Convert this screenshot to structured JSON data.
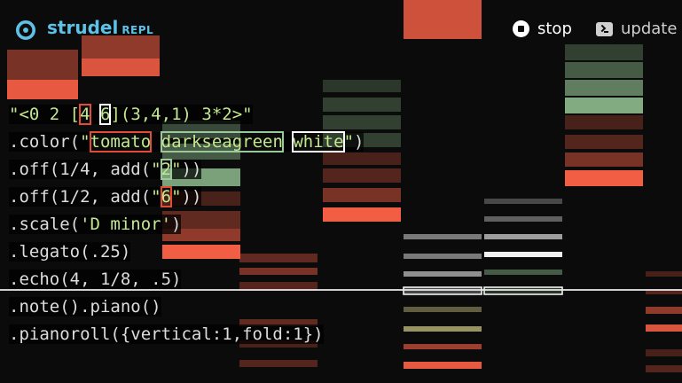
{
  "header": {
    "title": "strudel",
    "subtitle": "REPL",
    "stop_label": "stop",
    "update_label": "update",
    "icons": [
      "strudel-logo-icon",
      "stop-icon",
      "update-icon"
    ]
  },
  "colors": {
    "tomato": "#ff6347",
    "darkseagreen": "#8fbc8f",
    "white": "#ffffff",
    "brand": "#5ec2e6"
  },
  "code": {
    "lines": [
      {
        "segments": [
          {
            "t": "\"<0 2 [",
            "c": "str"
          },
          {
            "t": "4",
            "c": "str",
            "h": "red"
          },
          {
            "t": " ",
            "c": "str"
          },
          {
            "t": "6",
            "c": "str",
            "h": "white"
          },
          {
            "t": "](3,4,1) 3*2>\"",
            "c": "str"
          }
        ]
      },
      {
        "segments": [
          {
            "t": ".color(",
            "c": "text"
          },
          {
            "t": "\"",
            "c": "str"
          },
          {
            "t": "tomato",
            "c": "str",
            "h": "red"
          },
          {
            "t": " ",
            "c": "str"
          },
          {
            "t": "darkseagreen",
            "c": "str",
            "h": "green"
          },
          {
            "t": " ",
            "c": "str"
          },
          {
            "t": "white",
            "c": "str",
            "h": "white"
          },
          {
            "t": "\"",
            "c": "str"
          },
          {
            "t": ")",
            "c": "text"
          }
        ]
      },
      {
        "segments": [
          {
            "t": ".off(1/4, add(",
            "c": "text"
          },
          {
            "t": "\"",
            "c": "str"
          },
          {
            "t": "2",
            "c": "str",
            "h": "green"
          },
          {
            "t": "\"",
            "c": "str"
          },
          {
            "t": "))",
            "c": "text"
          }
        ]
      },
      {
        "segments": [
          {
            "t": ".off(1/2, add(",
            "c": "text"
          },
          {
            "t": "\"",
            "c": "str"
          },
          {
            "t": "6",
            "c": "str",
            "h": "red"
          },
          {
            "t": "\"",
            "c": "str"
          },
          {
            "t": "))",
            "c": "text"
          }
        ]
      },
      {
        "segments": [
          {
            "t": ".scale(",
            "c": "text"
          },
          {
            "t": "'D minor'",
            "c": "str"
          },
          {
            "t": ")",
            "c": "text"
          }
        ]
      },
      {
        "segments": [
          {
            "t": ".legato(.25)",
            "c": "text"
          }
        ]
      },
      {
        "segments": [
          {
            "t": ".echo(4, 1/8, .5)",
            "c": "text"
          }
        ]
      },
      {
        "segments": [
          {
            "t": ".note().piano()",
            "c": "text"
          }
        ]
      },
      {
        "segments": [
          {
            "t": ".pianoroll({vertical:1,fold:1})",
            "c": "text"
          }
        ]
      }
    ]
  }
}
